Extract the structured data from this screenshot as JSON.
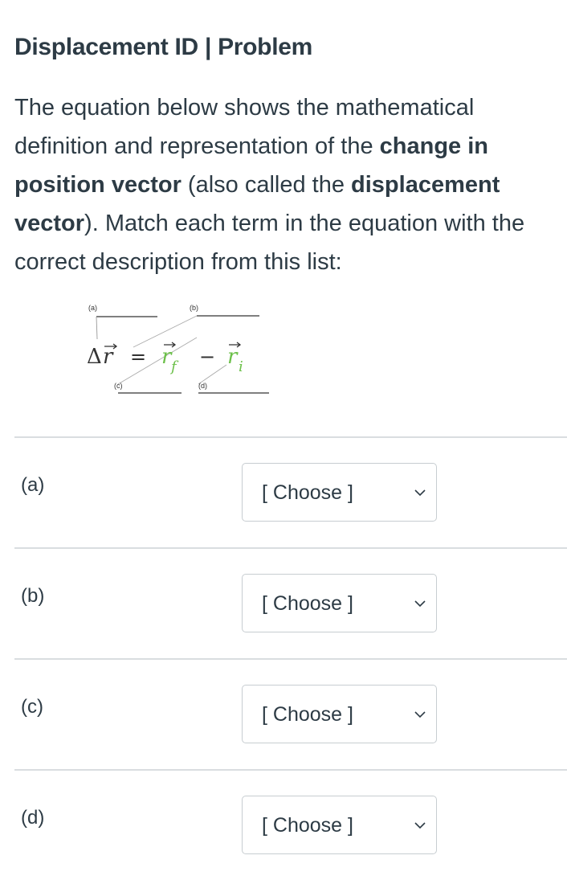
{
  "header": {
    "title": "Displacement ID  |  Problem"
  },
  "prompt": {
    "p1": "The equation below shows the mathematical definition and representation of the ",
    "b1": "change in position vector",
    "p2": " (also called the ",
    "b2": "displacement vector",
    "p3": ").  Match each term in the equation with the correct description from this list:"
  },
  "figure": {
    "label_a": "(a)",
    "label_b": "(b)",
    "label_c": "(c)",
    "label_d": "(d)",
    "delta": "Δ",
    "r": "r",
    "equals": "=",
    "minus": "−",
    "sub_f": "f",
    "sub_i": "i",
    "colors": {
      "green": "#6cc04a",
      "line": "#333333"
    }
  },
  "rows": [
    {
      "label": "(a)",
      "select": "[ Choose ]"
    },
    {
      "label": "(b)",
      "select": "[ Choose ]"
    },
    {
      "label": "(c)",
      "select": "[ Choose ]"
    },
    {
      "label": "(d)",
      "select": "[ Choose ]"
    }
  ],
  "icons": {
    "dropdown": "chevron-down-icon"
  }
}
